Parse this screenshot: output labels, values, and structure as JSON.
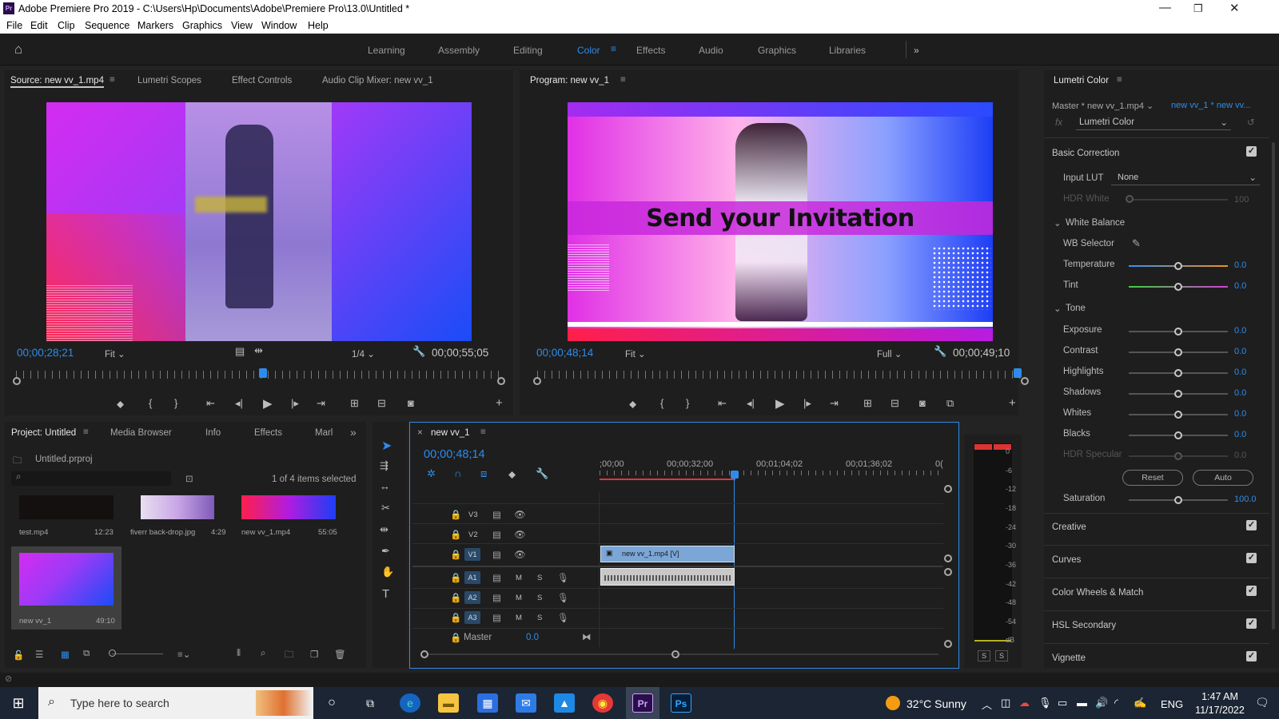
{
  "title_bar": {
    "app_logo": "Pr",
    "title": "Adobe Premiere Pro 2019 - C:\\Users\\Hp\\Documents\\Adobe\\Premiere Pro\\13.0\\Untitled *"
  },
  "menu": [
    "File",
    "Edit",
    "Clip",
    "Sequence",
    "Markers",
    "Graphics",
    "View",
    "Window",
    "Help"
  ],
  "workspaces": [
    "Learning",
    "Assembly",
    "Editing",
    "Color",
    "Effects",
    "Audio",
    "Graphics",
    "Libraries"
  ],
  "active_workspace": "Color",
  "source_panel": {
    "tabs": [
      "Source: new  vv_1.mp4",
      "Lumetri Scopes",
      "Effect Controls",
      "Audio Clip Mixer: new  vv_1"
    ],
    "timecode": "00;00;28;21",
    "fit": "Fit",
    "resolution": "1/4",
    "duration": "00;00;55;05",
    "playhead_fraction": 0.51
  },
  "program_panel": {
    "tab": "Program: new  vv_1",
    "timecode": "00;00;48;14",
    "fit": "Fit",
    "resolution": "Full",
    "duration": "00;00;49;10",
    "overlay_text": "Send your Invitation",
    "playhead_fraction": 0.985
  },
  "project_panel": {
    "tabs": [
      "Project: Untitled",
      "Media Browser",
      "Info",
      "Effects",
      "Marl"
    ],
    "project_file": "Untitled.prproj",
    "selection_info": "1 of 4 items selected",
    "search_placeholder": "",
    "items": [
      {
        "name": "test.mp4",
        "duration": "12:23"
      },
      {
        "name": "fiverr back-drop.jpg",
        "duration": "4:29"
      },
      {
        "name": "new  vv_1.mp4",
        "duration": "55:05"
      },
      {
        "name": "new  vv_1",
        "duration": "49:10"
      }
    ]
  },
  "timeline": {
    "sequence_tab": "new  vv_1",
    "timecode": "00;00;48;14",
    "ruler_labels": [
      ";00;00",
      "00;00;32;00",
      "00;01;04;02",
      "00;01;36;02",
      "0("
    ],
    "tracks_video": [
      "V3",
      "V2",
      "V1"
    ],
    "tracks_audio": [
      "A1",
      "A2",
      "A3"
    ],
    "master_label": "Master",
    "master_value": "0.0",
    "video_clip": "new  vv_1.mp4 [V]",
    "m_label": "M",
    "s_label": "S"
  },
  "audio_meter": {
    "labels": [
      "0",
      "-6",
      "-12",
      "-18",
      "-24",
      "-30",
      "-36",
      "-42",
      "-48",
      "-54",
      "dB"
    ],
    "solo_labels": [
      "S",
      "S"
    ]
  },
  "lumetri": {
    "title": "Lumetri Color",
    "master_label": "Master * new  vv_1.mp4",
    "seq_label": "new  vv_1 * new  vv...",
    "fx_label": "fx",
    "effect_name": "Lumetri Color",
    "basic_correction": "Basic Correction",
    "input_lut_label": "Input LUT",
    "input_lut_value": "None",
    "hdr_white_label": "HDR White",
    "hdr_white_value": "100",
    "white_balance": "White Balance",
    "wb_selector": "WB Selector",
    "tone": "Tone",
    "controls": [
      {
        "label": "Temperature",
        "value": "0.0"
      },
      {
        "label": "Tint",
        "value": "0.0"
      },
      {
        "label": "Exposure",
        "value": "0.0"
      },
      {
        "label": "Contrast",
        "value": "0.0"
      },
      {
        "label": "Highlights",
        "value": "0.0"
      },
      {
        "label": "Shadows",
        "value": "0.0"
      },
      {
        "label": "Whites",
        "value": "0.0"
      },
      {
        "label": "Blacks",
        "value": "0.0"
      },
      {
        "label": "HDR Specular",
        "value": "0.0"
      }
    ],
    "reset_label": "Reset",
    "auto_label": "Auto",
    "saturation_label": "Saturation",
    "saturation_value": "100.0",
    "sections": [
      "Creative",
      "Curves",
      "Color Wheels & Match",
      "HSL Secondary",
      "Vignette"
    ]
  },
  "taskbar": {
    "search_placeholder": "Type here to search",
    "weather": "32°C  Sunny",
    "lang": "ENG",
    "time": "1:47 AM",
    "date": "11/17/2022",
    "apps": [
      "Pr",
      "Ps"
    ]
  },
  "colors": {
    "accent": "#2d8ceb",
    "panel": "#1e1e1e",
    "taskbar": "#1c2533"
  }
}
